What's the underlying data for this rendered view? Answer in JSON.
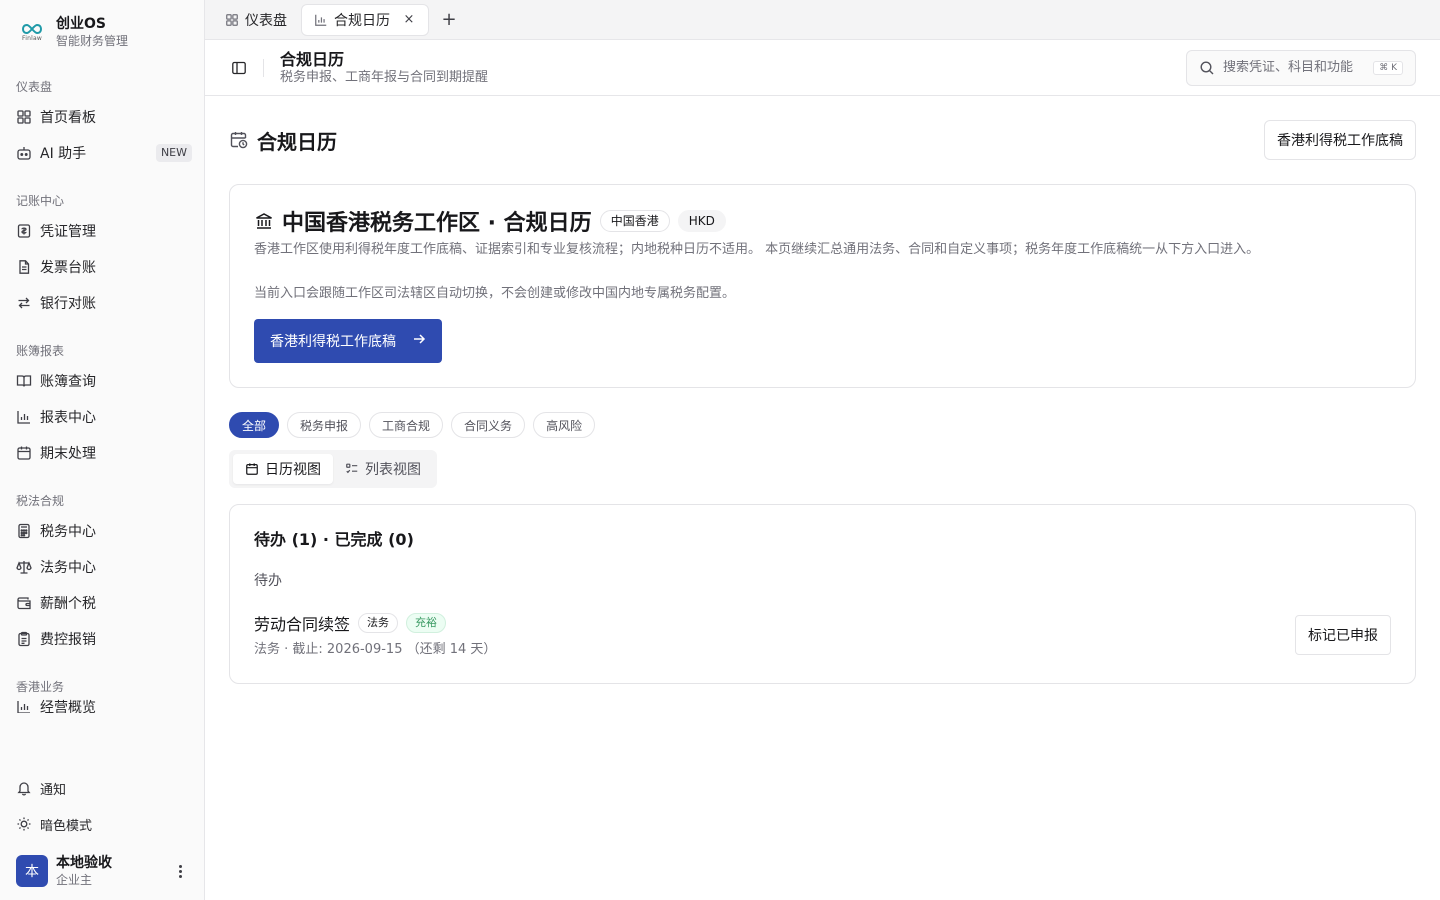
{
  "brand": {
    "name": "创业OS",
    "subtitle": "智能财务管理",
    "logo_text": "Finlaw"
  },
  "sidebar": {
    "groups": [
      {
        "label": "仪表盘",
        "items": [
          {
            "label": "首页看板",
            "icon": "grid-icon"
          },
          {
            "label": "AI 助手",
            "icon": "bot-icon",
            "badge": "NEW"
          }
        ]
      },
      {
        "label": "记账中心",
        "items": [
          {
            "label": "凭证管理",
            "icon": "receipt-icon"
          },
          {
            "label": "发票台账",
            "icon": "file-text-icon"
          },
          {
            "label": "银行对账",
            "icon": "arrows-swap-icon"
          }
        ]
      },
      {
        "label": "账簿报表",
        "items": [
          {
            "label": "账簿查询",
            "icon": "book-open-icon"
          },
          {
            "label": "报表中心",
            "icon": "bar-chart-icon"
          },
          {
            "label": "期末处理",
            "icon": "calendar-icon"
          }
        ]
      },
      {
        "label": "税法合规",
        "items": [
          {
            "label": "税务中心",
            "icon": "calculator-icon"
          },
          {
            "label": "法务中心",
            "icon": "scale-icon"
          },
          {
            "label": "薪酬个税",
            "icon": "wallet-icon"
          },
          {
            "label": "费控报销",
            "icon": "clipboard-icon"
          }
        ]
      },
      {
        "label": "香港业务",
        "items": [
          {
            "label": "经营概览",
            "icon": "bar-chart-icon"
          }
        ]
      }
    ],
    "bottom": {
      "notifications_label": "通知",
      "dark_mode_label": "暗色模式"
    },
    "user": {
      "avatar_text": "本",
      "name": "本地验收",
      "role": "企业主"
    }
  },
  "tabs": [
    {
      "label": "仪表盘",
      "icon": "grid-icon",
      "active": false
    },
    {
      "label": "合规日历",
      "icon": "bar-chart-icon",
      "active": true,
      "close": "×"
    }
  ],
  "tab_add": "+",
  "header": {
    "title": "合规日历",
    "subtitle": "税务申报、工商年报与合同到期提醒",
    "search_placeholder": "搜索凭证、科目和功能",
    "search_shortcut": "⌘ K"
  },
  "page": {
    "title": "合规日历",
    "top_button": "香港利得税工作底稿"
  },
  "hk_card": {
    "title": "中国香港税务工作区 · 合规日历",
    "pills": [
      "中国香港",
      "HKD"
    ],
    "description": "香港工作区使用利得税年度工作底稿、证据索引和专业复核流程；内地税种日历不适用。 本页继续汇总通用法务、合同和自定义事项；税务年度工作底稿统一从下方入口进入。",
    "note": "当前入口会跟随工作区司法辖区自动切换，不会创建或修改中国内地专属税务配置。",
    "button": "香港利得税工作底稿"
  },
  "filters": [
    {
      "label": "全部",
      "active": true
    },
    {
      "label": "税务申报",
      "active": false
    },
    {
      "label": "工商合规",
      "active": false
    },
    {
      "label": "合同义务",
      "active": false
    },
    {
      "label": "高风险",
      "active": false
    }
  ],
  "view_toggle": {
    "calendar_label": "日历视图",
    "list_label": "列表视图",
    "active": "calendar"
  },
  "list": {
    "heading": "待办 (1) · 已完成 (0)",
    "section_label": "待办",
    "items": [
      {
        "title": "劳动合同续签",
        "tags": [
          "法务",
          "充裕"
        ],
        "meta": "法务 · 截止: 2026-09-15 （还剩 14 天）",
        "action": "标记已申报"
      }
    ]
  },
  "colors": {
    "primary": "#2f4bb0",
    "success_text": "#3a9a63",
    "success_bg": "#ecfdf3"
  }
}
